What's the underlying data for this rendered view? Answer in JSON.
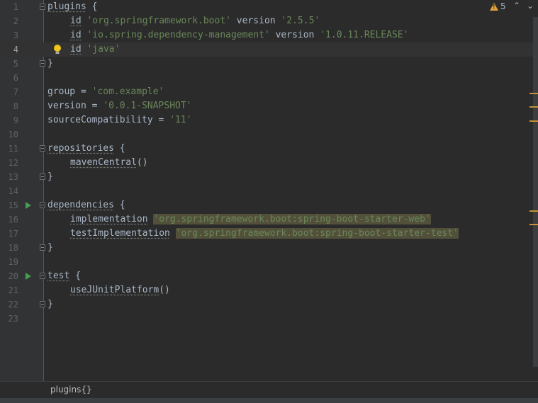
{
  "editor": {
    "lines": [
      {
        "n": "1",
        "segments": [
          {
            "t": "plugins",
            "und": true
          },
          {
            "t": " {"
          }
        ]
      },
      {
        "n": "2",
        "segments": [
          {
            "t": "id",
            "und": true
          },
          {
            "t": " "
          },
          {
            "t": "'org.springframework.boot'",
            "str": true
          },
          {
            "t": " version "
          },
          {
            "t": "'2.5.5'",
            "str": true
          }
        ]
      },
      {
        "n": "3",
        "segments": [
          {
            "t": "id",
            "und": true
          },
          {
            "t": " "
          },
          {
            "t": "'io.spring.dependency-management'",
            "str": true
          },
          {
            "t": " version "
          },
          {
            "t": "'1.0.11.RELEASE'",
            "str": true
          }
        ]
      },
      {
        "n": "4",
        "segments": [
          {
            "t": "id",
            "und": true
          },
          {
            "t": " "
          },
          {
            "t": "'java'",
            "str": true
          }
        ]
      },
      {
        "n": "5",
        "segments": [
          {
            "t": "}"
          }
        ]
      },
      {
        "n": "6",
        "segments": []
      },
      {
        "n": "7",
        "segments": [
          {
            "t": "group = "
          },
          {
            "t": "'com.example'",
            "str": true
          }
        ]
      },
      {
        "n": "8",
        "segments": [
          {
            "t": "version = "
          },
          {
            "t": "'0.0.1-SNAPSHOT'",
            "str": true
          }
        ]
      },
      {
        "n": "9",
        "segments": [
          {
            "t": "sourceCompatibility = "
          },
          {
            "t": "'11'",
            "str": true
          }
        ]
      },
      {
        "n": "10",
        "segments": []
      },
      {
        "n": "11",
        "segments": [
          {
            "t": "repositories",
            "und": true
          },
          {
            "t": " {"
          }
        ]
      },
      {
        "n": "12",
        "segments": [
          {
            "t": "mavenCentral",
            "und": true
          },
          {
            "t": "()"
          }
        ]
      },
      {
        "n": "13",
        "segments": [
          {
            "t": "}"
          }
        ]
      },
      {
        "n": "14",
        "segments": []
      },
      {
        "n": "15",
        "segments": [
          {
            "t": "dependencies",
            "und": true
          },
          {
            "t": " {"
          }
        ]
      },
      {
        "n": "16",
        "segments": [
          {
            "t": "implementation",
            "und": true
          },
          {
            "t": " "
          },
          {
            "t": "'org.springframework.boot:spring-boot-starter-web'",
            "str": true,
            "hl": true
          }
        ]
      },
      {
        "n": "17",
        "segments": [
          {
            "t": "testImplementation",
            "und": true
          },
          {
            "t": " "
          },
          {
            "t": "'org.springframework.boot:spring-boot-starter-test'",
            "str": true,
            "hl": true
          }
        ]
      },
      {
        "n": "18",
        "segments": [
          {
            "t": "}"
          }
        ]
      },
      {
        "n": "19",
        "segments": []
      },
      {
        "n": "20",
        "segments": [
          {
            "t": "test",
            "und": true
          },
          {
            "t": " {"
          }
        ]
      },
      {
        "n": "21",
        "segments": [
          {
            "t": "useJUnitPlatform",
            "und": true
          },
          {
            "t": "()"
          }
        ]
      },
      {
        "n": "22",
        "segments": [
          {
            "t": "}"
          }
        ]
      },
      {
        "n": "23",
        "segments": []
      }
    ],
    "current_line": "4"
  },
  "inspections": {
    "warning_count": "5",
    "warning_icon": "warning-triangle-icon",
    "prev_icon_glyph": "⌃",
    "next_icon_glyph": "⌄"
  },
  "breadcrumb": "plugins{}",
  "colors": {
    "background": "#2b2b2b",
    "gutter": "#313335",
    "string": "#6a8759",
    "highlight": "#52503a",
    "warning": "#e3a33a",
    "run": "#499c54"
  }
}
